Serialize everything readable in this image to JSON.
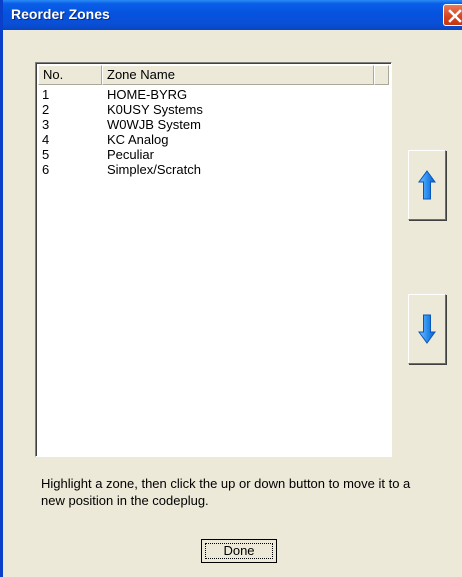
{
  "window": {
    "title": "Reorder Zones"
  },
  "list": {
    "columns": [
      "No.",
      "Zone Name"
    ],
    "rows": [
      {
        "no": "1",
        "name": "HOME-BYRG"
      },
      {
        "no": "2",
        "name": "K0USY Systems"
      },
      {
        "no": "3",
        "name": "W0WJB System"
      },
      {
        "no": "4",
        "name": "KC Analog"
      },
      {
        "no": "5",
        "name": "Peculiar"
      },
      {
        "no": "6",
        "name": "Simplex/Scratch"
      }
    ]
  },
  "buttons": {
    "up_icon": "arrow-up-icon",
    "down_icon": "arrow-down-icon",
    "done_label": "Done"
  },
  "hint": "Highlight a zone, then click the up or down button to move it to a new position in the codeplug.",
  "colors": {
    "titlebar": "#0553df",
    "window_bg": "#ece9d8",
    "arrow_blue": "#1e7fe0"
  }
}
